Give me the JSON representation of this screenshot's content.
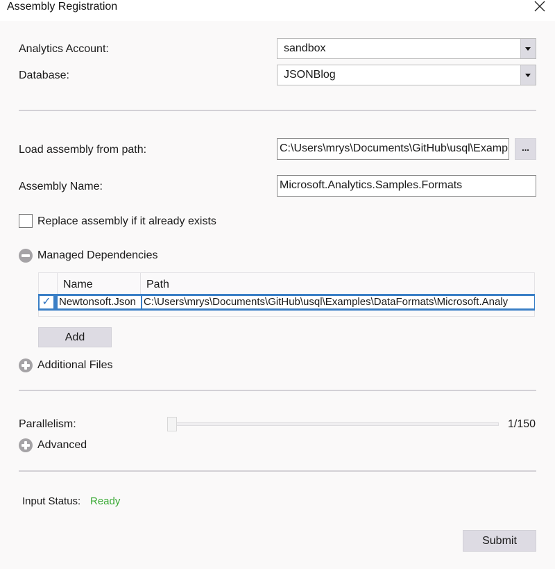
{
  "window": {
    "title": "Assembly Registration",
    "close_icon": "close-icon"
  },
  "account": {
    "analytics_account_label": "Analytics Account:",
    "analytics_account_value": "sandbox",
    "database_label": "Database:",
    "database_value": "JSONBlog"
  },
  "assembly": {
    "load_path_label": "Load assembly from path:",
    "load_path_value": "C:\\Users\\mrys\\Documents\\GitHub\\usql\\Examp",
    "browse_label": "...",
    "name_label": "Assembly Name:",
    "name_value": "Microsoft.Analytics.Samples.Formats",
    "replace_label": "Replace assembly if it already exists",
    "replace_checked": false
  },
  "managed_dependencies": {
    "label": "Managed Dependencies",
    "expanded": true,
    "columns": [
      "Name",
      "Path"
    ],
    "rows": [
      {
        "checked": true,
        "check_glyph": "✓",
        "name": "Newtonsoft.Json",
        "path": "C:\\Users\\mrys\\Documents\\GitHub\\usql\\Examples\\DataFormats\\Microsoft.Analy"
      }
    ],
    "add_label": "Add"
  },
  "additional_files": {
    "label": "Additional Files",
    "expanded": false
  },
  "parallelism": {
    "label": "Parallelism:",
    "value": 1,
    "max": 150,
    "readout": "1/150"
  },
  "advanced": {
    "label": "Advanced",
    "expanded": false
  },
  "status": {
    "label": "Input Status:",
    "value": "Ready",
    "color": "#3aaa35"
  },
  "footer": {
    "submit_label": "Submit"
  }
}
